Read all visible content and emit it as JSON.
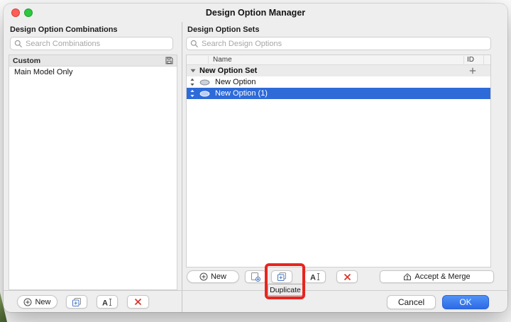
{
  "window": {
    "title": "Design Option Manager"
  },
  "left_panel": {
    "title": "Design Option Combinations",
    "search_placeholder": "Search Combinations",
    "list_header": "Custom",
    "items": [
      {
        "label": "Main Model Only"
      }
    ],
    "new_button": "New"
  },
  "right_panel": {
    "title": "Design Option Sets",
    "search_placeholder": "Search Design Options",
    "col_name": "Name",
    "col_id": "ID",
    "rows": [
      {
        "label": "New Option Set",
        "type": "set",
        "expanded": true
      },
      {
        "label": "New Option",
        "type": "option",
        "selected": false
      },
      {
        "label": "New Option (1)",
        "type": "option",
        "selected": true
      }
    ],
    "new_button": "New",
    "accept_merge_button": "Accept & Merge"
  },
  "tooltip": "Duplicate",
  "footer": {
    "cancel": "Cancel",
    "ok": "OK"
  },
  "icons": {
    "search": "magnifier",
    "save": "floppy-disk",
    "new": "circle-plus",
    "new_option": "sheet-plus",
    "duplicate": "overlapping-squares-plus",
    "rename": "letter-A-text-cursor",
    "delete": "red-x",
    "reorder": "up-down-arrows",
    "visibility": "eye",
    "disclosure": "triangle-down",
    "add_in_row": "plus",
    "accept_merge": "merge-house-arrow"
  },
  "colors": {
    "selection_blue": "#2e6bd8",
    "ok_blue": "#2d6ae6",
    "annotation_red": "#e8251f",
    "delete_red": "#d8362a",
    "window_bg": "#eeeeee"
  }
}
